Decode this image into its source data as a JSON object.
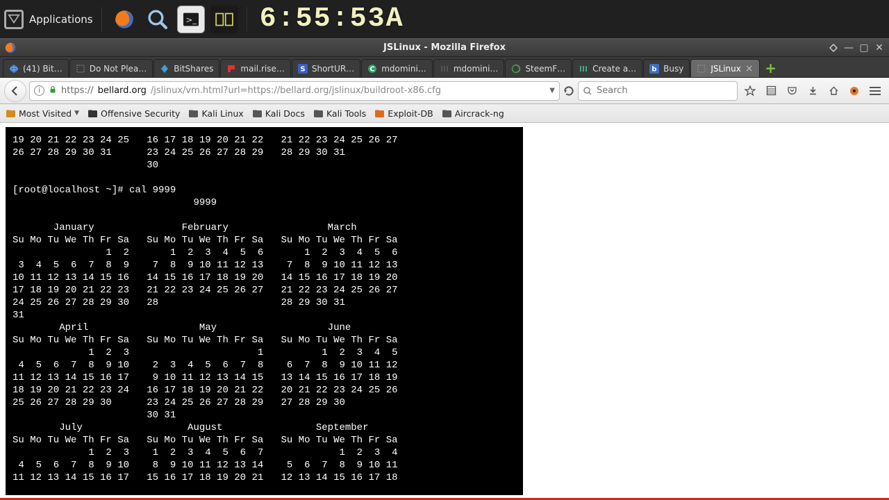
{
  "panel": {
    "applications": "Applications",
    "clock": "6:55:53A"
  },
  "titlebar": {
    "title": "JSLinux - Mozilla Firefox"
  },
  "tabs": [
    {
      "label": "(41) Bit…",
      "icon": "globe"
    },
    {
      "label": "Do Not Plea…",
      "icon": "blank"
    },
    {
      "label": "BitShares",
      "icon": "bitshares"
    },
    {
      "label": "mail.rise…",
      "icon": "flag"
    },
    {
      "label": "ShortUR…",
      "icon": "s"
    },
    {
      "label": "mdomini…",
      "icon": "c"
    },
    {
      "label": "mdomini…",
      "icon": "bars"
    },
    {
      "label": "SteemF…",
      "icon": "swirl"
    },
    {
      "label": "Create a…",
      "icon": "bars2"
    },
    {
      "label": "Busy",
      "icon": "b"
    },
    {
      "label": "JSLinux",
      "icon": "blank",
      "active": true
    }
  ],
  "newtab_glyph": "+",
  "url": {
    "scheme": "https://",
    "host": "bellard.org",
    "path": "/jslinux/vm.html?url=https://bellard.org/jslinux/buildroot-x86.cfg"
  },
  "search": {
    "placeholder": "Search"
  },
  "bookmarks": [
    {
      "label": "Most Visited",
      "chevron": true,
      "color": "#d38b1c"
    },
    {
      "label": "Offensive Security",
      "color": "#333"
    },
    {
      "label": "Kali Linux",
      "color": "#555"
    },
    {
      "label": "Kali Docs",
      "color": "#555"
    },
    {
      "label": "Kali Tools",
      "color": "#555"
    },
    {
      "label": "Exploit-DB",
      "color": "#e06a1a"
    },
    {
      "label": "Aircrack-ng",
      "color": "#555"
    }
  ],
  "terminal": {
    "prompt": "[root@localhost ~]# cal 9999",
    "lines": [
      "19 20 21 22 23 24 25   16 17 18 19 20 21 22   21 22 23 24 25 26 27",
      "26 27 28 29 30 31      23 24 25 26 27 28 29   28 29 30 31",
      "                       30",
      "",
      "[root@localhost ~]# cal 9999",
      "                               9999",
      "",
      "       January               February                 March",
      "Su Mo Tu We Th Fr Sa   Su Mo Tu We Th Fr Sa   Su Mo Tu We Th Fr Sa",
      "                1  2       1  2  3  4  5  6       1  2  3  4  5  6",
      " 3  4  5  6  7  8  9    7  8  9 10 11 12 13    7  8  9 10 11 12 13",
      "10 11 12 13 14 15 16   14 15 16 17 18 19 20   14 15 16 17 18 19 20",
      "17 18 19 20 21 22 23   21 22 23 24 25 26 27   21 22 23 24 25 26 27",
      "24 25 26 27 28 29 30   28                     28 29 30 31",
      "31",
      "        April                   May                   June",
      "Su Mo Tu We Th Fr Sa   Su Mo Tu We Th Fr Sa   Su Mo Tu We Th Fr Sa",
      "             1  2  3                      1          1  2  3  4  5",
      " 4  5  6  7  8  9 10    2  3  4  5  6  7  8    6  7  8  9 10 11 12",
      "11 12 13 14 15 16 17    9 10 11 12 13 14 15   13 14 15 16 17 18 19",
      "18 19 20 21 22 23 24   16 17 18 19 20 21 22   20 21 22 23 24 25 26",
      "25 26 27 28 29 30      23 24 25 26 27 28 29   27 28 29 30",
      "                       30 31",
      "        July                  August                September",
      "Su Mo Tu We Th Fr Sa   Su Mo Tu We Th Fr Sa   Su Mo Tu We Th Fr Sa",
      "             1  2  3    1  2  3  4  5  6  7             1  2  3  4",
      " 4  5  6  7  8  9 10    8  9 10 11 12 13 14    5  6  7  8  9 10 11",
      "11 12 13 14 15 16 17   15 16 17 18 19 20 21   12 13 14 15 16 17 18"
    ]
  }
}
